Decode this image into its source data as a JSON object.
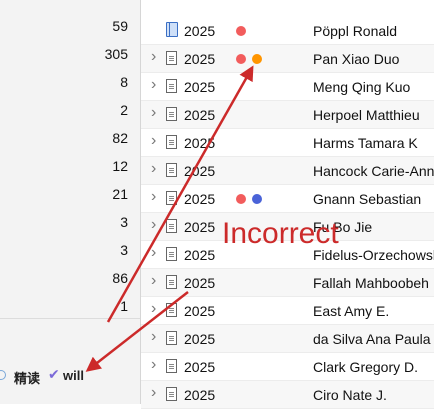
{
  "left_counts": [
    "59",
    "305",
    "8",
    "2",
    "82",
    "12",
    "21",
    "3",
    "3",
    "86",
    "1"
  ],
  "tags": {
    "read": "精读",
    "check_icon": "checkmark-icon",
    "will": "will"
  },
  "rows": [
    {
      "year": "2025",
      "author": "Pöppl Ronald",
      "icon": "book-icon",
      "expandable": false,
      "dots": [
        "#f25c5c"
      ]
    },
    {
      "year": "2025",
      "author": "Pan Xiao Duo",
      "icon": "document-icon",
      "expandable": true,
      "dots": [
        "#f25c5c",
        "#ff9500"
      ]
    },
    {
      "year": "2025",
      "author": "Meng Qing Kuo",
      "icon": "document-icon",
      "expandable": true,
      "dots": []
    },
    {
      "year": "2025",
      "author": "Herpoel Matthieu",
      "icon": "document-icon",
      "expandable": true,
      "dots": []
    },
    {
      "year": "2025",
      "author": "Harms Tamara K",
      "icon": "document-icon",
      "expandable": true,
      "dots": []
    },
    {
      "year": "2025",
      "author": "Hancock Carie-Ann",
      "icon": "document-icon",
      "expandable": true,
      "dots": []
    },
    {
      "year": "2025",
      "author": "Gnann Sebastian",
      "icon": "document-icon",
      "expandable": true,
      "dots": [
        "#f25c5c",
        "#4a63d8"
      ]
    },
    {
      "year": "2025",
      "author": "Fu Bo Jie",
      "icon": "document-icon",
      "expandable": true,
      "dots": []
    },
    {
      "year": "2025",
      "author": "Fidelus-Orzechowska",
      "icon": "document-icon",
      "expandable": true,
      "dots": []
    },
    {
      "year": "2025",
      "author": "Fallah Mahboobeh",
      "icon": "document-icon",
      "expandable": true,
      "dots": []
    },
    {
      "year": "2025",
      "author": "East Amy E.",
      "icon": "document-icon",
      "expandable": true,
      "dots": []
    },
    {
      "year": "2025",
      "author": "da Silva Ana Paula",
      "icon": "document-icon",
      "expandable": true,
      "dots": []
    },
    {
      "year": "2025",
      "author": "Clark Gregory D.",
      "icon": "document-icon",
      "expandable": true,
      "dots": []
    },
    {
      "year": "2025",
      "author": "Ciro Nate J.",
      "icon": "document-icon",
      "expandable": true,
      "dots": []
    }
  ],
  "annotation": {
    "text": "Incorrect",
    "color": "#cc2a2a"
  },
  "colors": {
    "red": "#f25c5c",
    "orange": "#ff9500",
    "blue": "#4a63d8"
  }
}
